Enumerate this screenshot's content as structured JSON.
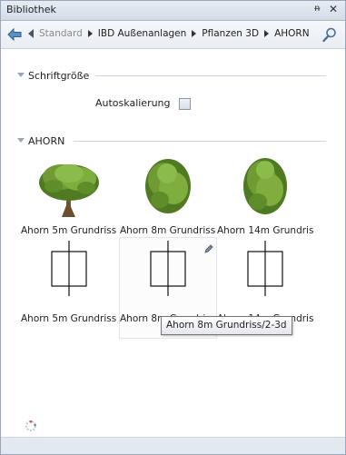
{
  "window": {
    "title": "Bibliothek",
    "pin_glyph": "ᵰ",
    "close_glyph": "✕"
  },
  "nav": {
    "back_icon": "back-arrow-icon",
    "search_icon": "search-icon",
    "breadcrumb": [
      "Standard",
      "IBD Außenanlagen",
      "Pflanzen 3D",
      "AHORN"
    ]
  },
  "sections": {
    "font": {
      "label": "Schriftgröße",
      "option_label": "Autoskalierung",
      "option_checked": false
    },
    "group": {
      "label": "AHORN"
    }
  },
  "items": [
    {
      "caption": "Ahorn 5m Grundriss...",
      "type": "tree-3d"
    },
    {
      "caption": "Ahorn 8m Grundriss...",
      "type": "tree-3d"
    },
    {
      "caption": "Ahorn 14m Grundris...",
      "type": "tree-3d"
    },
    {
      "caption": "Ahorn 5m Grundriss...",
      "type": "plan-2d"
    },
    {
      "caption": "Ahorn 8m Grundriss...",
      "type": "plan-2d",
      "selected": true
    },
    {
      "caption": "Ahorn 14m Grundris...",
      "type": "plan-2d"
    }
  ],
  "tooltip": "Ahorn 8m Grundriss/2-3d",
  "colors": {
    "accent": "#6f9a34",
    "tree_dark": "#4f7a22",
    "tree_light": "#8bbb4a",
    "trunk": "#7a5a36"
  }
}
